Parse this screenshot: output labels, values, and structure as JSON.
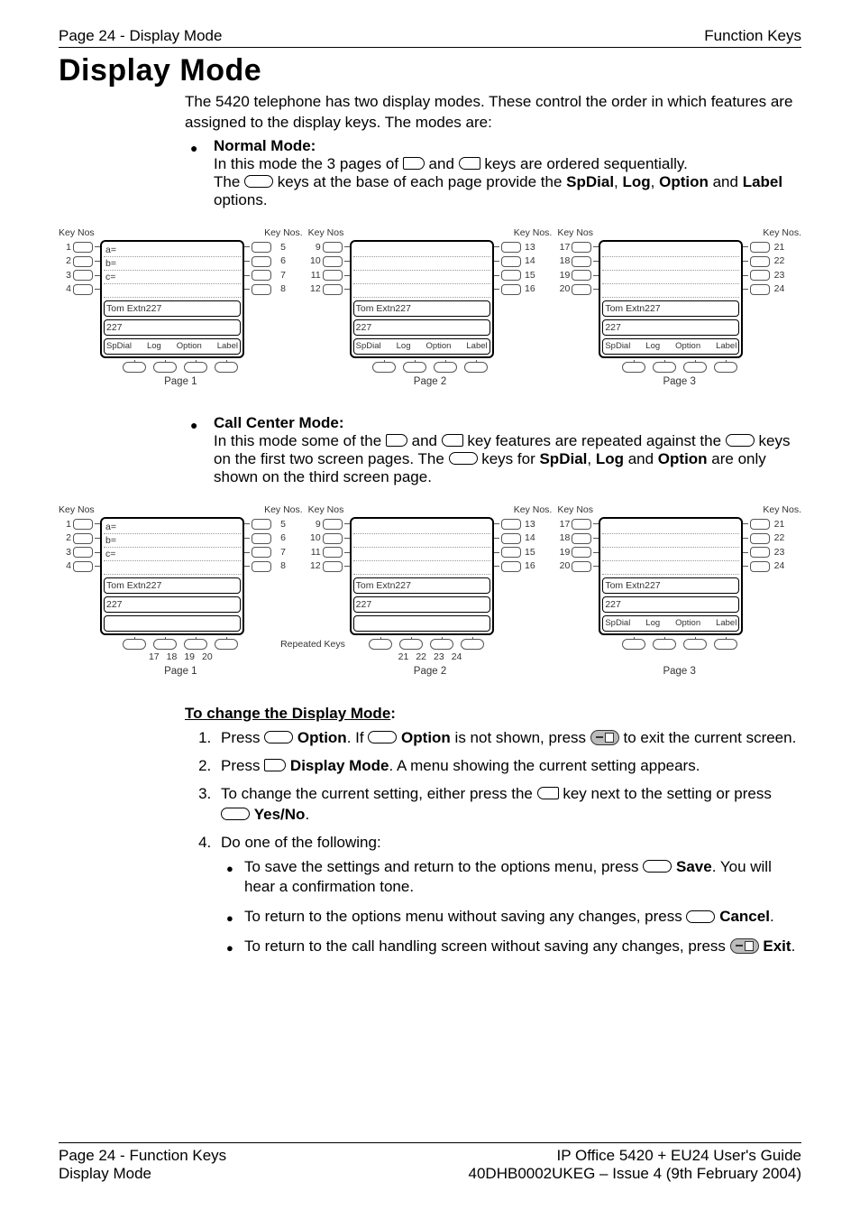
{
  "header": {
    "left": "Page 24 - Display Mode",
    "right": "Function Keys"
  },
  "title": "Display Mode",
  "intro1": "The 5420 telephone has two display modes. These control the order in which features are assigned to the display keys. The modes are:",
  "mode_normal": {
    "name": "Normal Mode:",
    "line1a": "In this mode the 3 pages of ",
    "line1b": " and ",
    "line1c": " keys are ordered sequentially.",
    "line2a": "The ",
    "line2b": " keys at the base of each page provide the ",
    "line2c": ", ",
    "line2d": ", ",
    "line2e": " and ",
    "line2f": " options.",
    "kw_spdial": "SpDial",
    "kw_log": "Log",
    "kw_option": "Option",
    "kw_label": "Label"
  },
  "mode_cc": {
    "name": "Call Center Mode:",
    "line1a": "In this mode some of the ",
    "line1b": " and ",
    "line1c": " key features are repeated against the ",
    "line1d": " keys on the first two screen pages. The ",
    "line1e": " keys for ",
    "line1f": ", ",
    "line1g": " and ",
    "line1h": " are only shown on the third screen page.",
    "kw_spdial": "SpDial",
    "kw_log": "Log",
    "kw_option": "Option"
  },
  "fig_labels": {
    "keynos": "Key Nos",
    "keynos_dot": "Key Nos.",
    "page1": "Page 1",
    "page2": "Page 2",
    "page3": "Page 3",
    "repeated": "Repeated Keys"
  },
  "fig_screen": {
    "a": "a=",
    "b": "b=",
    "c": "c=",
    "tom": "Tom Extn227",
    "e227": "227",
    "opt_spdial": "SpDial",
    "opt_log": "Log",
    "opt_option": "Option",
    "opt_label": "Label"
  },
  "fig_normal": {
    "p1_left": [
      "1",
      "2",
      "3",
      "4"
    ],
    "p1_right": [
      "5",
      "6",
      "7",
      "8"
    ],
    "p2_left": [
      "9",
      "10",
      "11",
      "12"
    ],
    "p2_right": [
      "13",
      "14",
      "15",
      "16"
    ],
    "p3_left": [
      "17",
      "18",
      "19",
      "20"
    ],
    "p3_right": [
      "21",
      "22",
      "23",
      "24"
    ]
  },
  "fig_cc": {
    "p1_left": [
      "1",
      "2",
      "3",
      "4"
    ],
    "p1_right": [
      "5",
      "6",
      "7",
      "8"
    ],
    "p1_foot": [
      "17",
      "18",
      "19",
      "20"
    ],
    "p2_left": [
      "9",
      "10",
      "11",
      "12"
    ],
    "p2_right": [
      "13",
      "14",
      "15",
      "16"
    ],
    "p2_foot": [
      "21",
      "22",
      "23",
      "24"
    ],
    "p3_left": [
      "17",
      "18",
      "19",
      "20"
    ],
    "p3_right": [
      "21",
      "22",
      "23",
      "24"
    ]
  },
  "steps_heading": "To change the Display Mode",
  "steps": {
    "s1a": "Press ",
    "s1b": "Option",
    "s1c": ". If ",
    "s1d": "Option",
    "s1e": " is not shown, press ",
    "s1f": " to exit the current screen.",
    "s2a": "Press ",
    "s2b": "Display Mode",
    "s2c": ". A menu showing the current setting appears.",
    "s3a": "To change the current setting, either press the ",
    "s3b": " key next to the setting or press ",
    "s3c": "Yes/No",
    "s3d": ".",
    "s4": "Do one of the following:",
    "s4_1a": "To save the settings and return to the options menu, press ",
    "s4_1b": "Save",
    "s4_1c": ". You will hear a confirmation tone.",
    "s4_2a": "To return to the options menu without saving any changes, press ",
    "s4_2b": "Cancel",
    "s4_2c": ".",
    "s4_3a": "To return to the call handling screen without saving any changes, press ",
    "s4_3b": "Exit",
    "s4_3c": "."
  },
  "footer": {
    "l1": "Page 24 - Function Keys",
    "l2": "Display Mode",
    "r1": "IP Office 5420 + EU24 User's Guide",
    "r2": "40DHB0002UKEG – Issue 4 (9th February 2004)"
  }
}
